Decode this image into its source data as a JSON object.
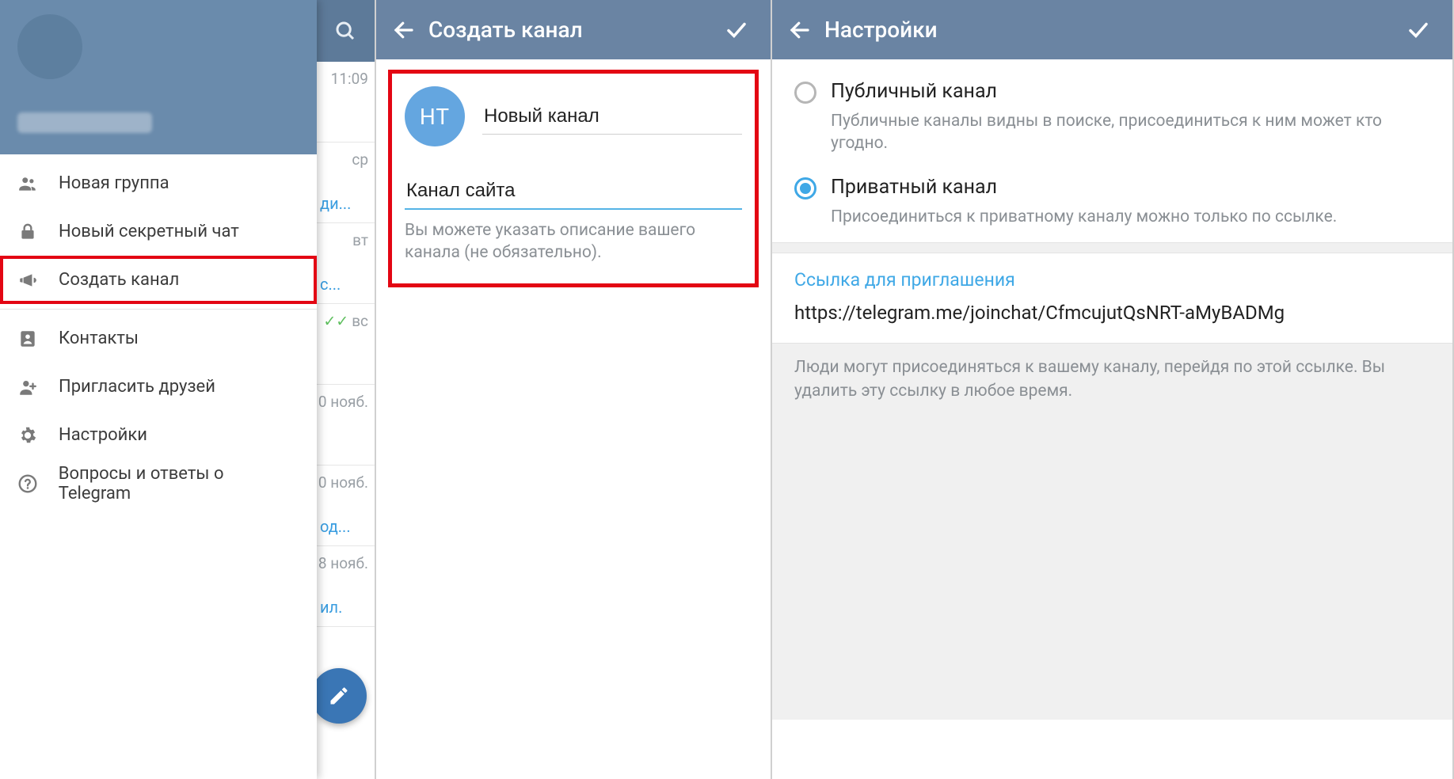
{
  "panel1": {
    "chat_peek": {
      "rows": [
        {
          "time": "11:09",
          "snippet": ""
        },
        {
          "time": "ср",
          "snippet": "ди..."
        },
        {
          "time": "вт",
          "snippet": "с...",
          "checks": false
        },
        {
          "time": "вс",
          "snippet": "",
          "checks": true
        },
        {
          "time": "0 нояб.",
          "snippet": ""
        },
        {
          "time": "0 нояб.",
          "snippet": "од..."
        },
        {
          "time": "8 нояб.",
          "snippet": "ил."
        }
      ]
    },
    "drawer": {
      "items": [
        {
          "icon": "group",
          "label": "Новая группа"
        },
        {
          "icon": "lock",
          "label": "Новый секретный чат"
        },
        {
          "icon": "megaphone",
          "label": "Создать канал",
          "highlight": true,
          "sep_after": true
        },
        {
          "icon": "contact",
          "label": "Контакты"
        },
        {
          "icon": "add-user",
          "label": "Пригласить друзей"
        },
        {
          "icon": "gear",
          "label": "Настройки"
        },
        {
          "icon": "help",
          "label": "Вопросы и ответы о Telegram"
        }
      ]
    }
  },
  "panel2": {
    "header_title": "Создать канал",
    "avatar_initials": "НТ",
    "name_value": "Новый канал",
    "desc_value": "Канал сайта",
    "hint": "Вы можете указать описание вашего канала (не обязательно)."
  },
  "panel3": {
    "header_title": "Настройки",
    "public_label": "Публичный канал",
    "public_sub": "Публичные каналы видны в поиске, присоединиться к ним может кто угодно.",
    "private_label": "Приватный канал",
    "private_sub": "Присоединиться к приватному каналу можно только по ссылке.",
    "link_title": "Ссылка для приглашения",
    "link_value": "https://telegram.me/joinchat/CfmcujutQsNRT-aMyBADMg",
    "link_footer": "Люди могут присоединяться к вашему каналу, перейдя по этой ссылке. Вы удалить эту ссылку в любое время."
  }
}
